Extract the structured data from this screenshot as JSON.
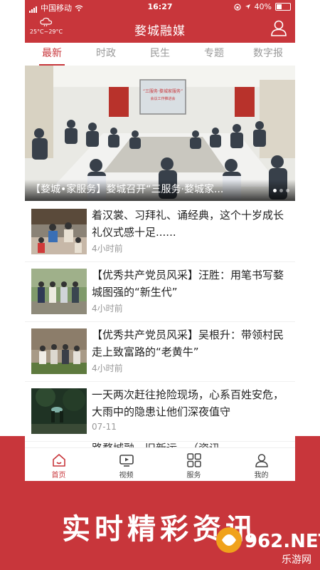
{
  "status_bar": {
    "carrier": "中国移动",
    "time": "16:27",
    "battery": "40%"
  },
  "header": {
    "weather": "25°C~29°C",
    "title": "婺城融媒"
  },
  "tabs": [
    {
      "label": "最新",
      "active": true
    },
    {
      "label": "时政",
      "active": false
    },
    {
      "label": "民生",
      "active": false
    },
    {
      "label": "专题",
      "active": false
    },
    {
      "label": "数字报",
      "active": false
    }
  ],
  "banner": {
    "caption": "【婺城•家服务】婺城召开“三服务·婺城家...",
    "screen_title": "“三服务·婺城家服务”",
    "screen_sub": "会议工作推进会"
  },
  "news": [
    {
      "title": "着汉裳、习拜礼、诵经典，这个十岁成长礼仪式感十足......",
      "time": "4小时前"
    },
    {
      "title": "【优秀共产党员风采】汪胜：用笔书写婺城图强的“新生代”",
      "time": "4小时前"
    },
    {
      "title": "【优秀共产党员风采】吴根升：带领村民走上致富路的“老黄牛”",
      "time": "4小时前"
    },
    {
      "title": "一天两次赶往抢险现场，心系百姓安危，大雨中的隐患让他们深夜值守",
      "time": "07-11"
    }
  ],
  "peek_text": "路婺城融…旧新运…（资讯",
  "nav": [
    {
      "label": "首页",
      "icon": "home-icon",
      "active": true
    },
    {
      "label": "视频",
      "icon": "tv-icon",
      "active": false
    },
    {
      "label": "服务",
      "icon": "grid-icon",
      "active": false
    },
    {
      "label": "我的",
      "icon": "user-icon",
      "active": false
    }
  ],
  "slogan": "实时精彩资讯",
  "watermark": {
    "brand": "962.NET",
    "sub": "乐游网"
  },
  "colors": {
    "brand_red": "#c8363b"
  }
}
